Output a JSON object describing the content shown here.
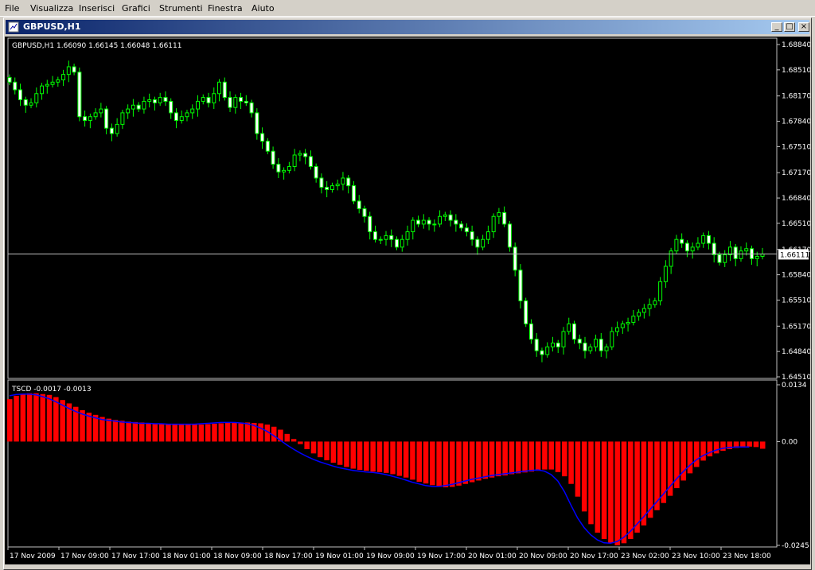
{
  "menu": [
    "File",
    "Visualizza",
    "Inserisci",
    "Grafici",
    "Strumenti",
    "Finestra",
    "Aiuto"
  ],
  "window": {
    "title": "GBPUSD,H1",
    "btn_min": "_",
    "btn_max": "□",
    "btn_close": "×"
  },
  "main_chart": {
    "header": "GBPUSD,H1  1.66090 1.66145 1.66048 1.66111",
    "price_ticks": [
      "1.68840",
      "1.68510",
      "1.68170",
      "1.67840",
      "1.67510",
      "1.67170",
      "1.66840",
      "1.66510",
      "1.66170",
      "1.65840",
      "1.65510",
      "1.65170",
      "1.64840",
      "1.64510"
    ],
    "current_price": "1.66111",
    "colors": {
      "bull": "#00ff00",
      "bear": "#ffffff",
      "bg": "#000000",
      "grid": "#c0c0c0"
    }
  },
  "indicator": {
    "header": "TSCD -0.0017 -0.0013",
    "ticks": [
      "0.0134",
      "0.00",
      "-0.0245"
    ],
    "colors": {
      "hist": "#ff0000",
      "signal": "#0000ff"
    }
  },
  "time_axis": [
    "17 Nov 2009",
    "17 Nov 09:00",
    "17 Nov 17:00",
    "18 Nov 01:00",
    "18 Nov 09:00",
    "18 Nov 17:00",
    "19 Nov 01:00",
    "19 Nov 09:00",
    "19 Nov 17:00",
    "20 Nov 01:00",
    "20 Nov 09:00",
    "20 Nov 17:00",
    "23 Nov 02:00",
    "23 Nov 10:00",
    "23 Nov 18:00"
  ],
  "chart_data": [
    {
      "type": "candlestick",
      "title": "GBPUSD,H1",
      "ylim": [
        1.6451,
        1.6884
      ],
      "last_close": 1.66111,
      "closes": [
        1.6835,
        1.6825,
        1.6812,
        1.6805,
        1.6808,
        1.682,
        1.683,
        1.6832,
        1.6835,
        1.6838,
        1.6845,
        1.6855,
        1.6848,
        1.679,
        1.6785,
        1.679,
        1.6795,
        1.68,
        1.6775,
        1.6768,
        1.678,
        1.6795,
        1.68,
        1.6805,
        1.68,
        1.681,
        1.6812,
        1.6808,
        1.6815,
        1.681,
        1.6795,
        1.6785,
        1.679,
        1.6795,
        1.68,
        1.681,
        1.6815,
        1.6808,
        1.682,
        1.6835,
        1.6815,
        1.6802,
        1.6815,
        1.681,
        1.6808,
        1.6795,
        1.6768,
        1.6758,
        1.6745,
        1.6728,
        1.6718,
        1.672,
        1.6725,
        1.674,
        1.6742,
        1.6738,
        1.6725,
        1.671,
        1.6698,
        1.6695,
        1.67,
        1.6702,
        1.671,
        1.67,
        1.668,
        1.667,
        1.666,
        1.664,
        1.663,
        1.663,
        1.6635,
        1.663,
        1.662,
        1.663,
        1.664,
        1.6655,
        1.665,
        1.6655,
        1.665,
        1.665,
        1.666,
        1.6662,
        1.6655,
        1.665,
        1.6645,
        1.664,
        1.663,
        1.662,
        1.663,
        1.664,
        1.666,
        1.6665,
        1.665,
        1.662,
        1.659,
        1.655,
        1.652,
        1.65,
        1.6485,
        1.648,
        1.649,
        1.6495,
        1.649,
        1.651,
        1.652,
        1.65,
        1.6495,
        1.6485,
        1.649,
        1.65,
        1.6485,
        1.649,
        1.651,
        1.6515,
        1.652,
        1.6522,
        1.653,
        1.6535,
        1.654,
        1.6545,
        1.655,
        1.6575,
        1.6595,
        1.6615,
        1.663,
        1.6625,
        1.6615,
        1.662,
        1.6625,
        1.6635,
        1.6625,
        1.661,
        1.66,
        1.661,
        1.662,
        1.6605,
        1.6615,
        1.6618,
        1.6605,
        1.6608,
        1.6611
      ]
    },
    {
      "type": "bar",
      "title": "TSCD",
      "ylim": [
        -0.0245,
        0.0134
      ],
      "hist": [
        0.01,
        0.0108,
        0.0112,
        0.0114,
        0.0114,
        0.0112,
        0.011,
        0.0105,
        0.0098,
        0.009,
        0.0082,
        0.0074,
        0.0068,
        0.0063,
        0.0058,
        0.0054,
        0.0051,
        0.0049,
        0.0047,
        0.0046,
        0.0045,
        0.0044,
        0.0043,
        0.0043,
        0.0042,
        0.0041,
        0.0041,
        0.0041,
        0.004,
        0.004,
        0.0041,
        0.0042,
        0.0043,
        0.0044,
        0.0044,
        0.0045,
        0.0045,
        0.0044,
        0.0043,
        0.004,
        0.0035,
        0.0028,
        0.0018,
        0.0006,
        -0.0006,
        -0.0018,
        -0.0028,
        -0.0037,
        -0.0044,
        -0.005,
        -0.0055,
        -0.006,
        -0.0064,
        -0.0067,
        -0.0069,
        -0.0071,
        -0.0072,
        -0.0074,
        -0.0077,
        -0.0081,
        -0.0085,
        -0.009,
        -0.0095,
        -0.0099,
        -0.0103,
        -0.0107,
        -0.0108,
        -0.0107,
        -0.0104,
        -0.01,
        -0.0096,
        -0.0092,
        -0.0088,
        -0.0085,
        -0.0082,
        -0.008,
        -0.0077,
        -0.0075,
        -0.0073,
        -0.0071,
        -0.0069,
        -0.0066,
        -0.0066,
        -0.0072,
        -0.0082,
        -0.01,
        -0.013,
        -0.0165,
        -0.0195,
        -0.0215,
        -0.023,
        -0.024,
        -0.0245,
        -0.024,
        -0.023,
        -0.0215,
        -0.0198,
        -0.018,
        -0.0162,
        -0.0145,
        -0.0128,
        -0.011,
        -0.0092,
        -0.0075,
        -0.006,
        -0.0045,
        -0.0035,
        -0.0028,
        -0.0022,
        -0.0018,
        -0.0015,
        -0.0013,
        -0.0012,
        -0.0013,
        -0.0017
      ],
      "signal": [
        0.0108,
        0.0111,
        0.0112,
        0.0112,
        0.011,
        0.0106,
        0.0101,
        0.0094,
        0.0086,
        0.0078,
        0.0071,
        0.0065,
        0.006,
        0.0056,
        0.0052,
        0.005,
        0.0048,
        0.0046,
        0.0045,
        0.0044,
        0.0043,
        0.0043,
        0.0042,
        0.0042,
        0.0041,
        0.0041,
        0.0041,
        0.0041,
        0.0041,
        0.0042,
        0.0043,
        0.0044,
        0.0045,
        0.0045,
        0.0045,
        0.0044,
        0.0042,
        0.0038,
        0.0032,
        0.0024,
        0.0014,
        0.0003,
        -0.0008,
        -0.0018,
        -0.0027,
        -0.0035,
        -0.0042,
        -0.0048,
        -0.0053,
        -0.0058,
        -0.0062,
        -0.0065,
        -0.0068,
        -0.007,
        -0.0072,
        -0.0073,
        -0.0075,
        -0.0078,
        -0.0082,
        -0.0086,
        -0.0091,
        -0.0096,
        -0.01,
        -0.0104,
        -0.0106,
        -0.0106,
        -0.0104,
        -0.0101,
        -0.0097,
        -0.0093,
        -0.0089,
        -0.0086,
        -0.0083,
        -0.008,
        -0.0078,
        -0.0076,
        -0.0074,
        -0.0072,
        -0.007,
        -0.0068,
        -0.0067,
        -0.007,
        -0.0078,
        -0.0093,
        -0.0118,
        -0.015,
        -0.018,
        -0.0203,
        -0.022,
        -0.0232,
        -0.0239,
        -0.024,
        -0.0236,
        -0.0226,
        -0.0212,
        -0.0195,
        -0.0178,
        -0.016,
        -0.0142,
        -0.0124,
        -0.0106,
        -0.0088,
        -0.0071,
        -0.0056,
        -0.0043,
        -0.0033,
        -0.0026,
        -0.002,
        -0.0016,
        -0.0014,
        -0.0013,
        -0.0013,
        -0.0013
      ]
    }
  ]
}
